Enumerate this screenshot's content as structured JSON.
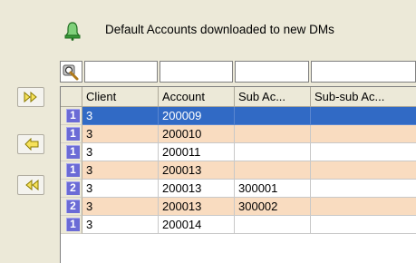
{
  "header": {
    "title": "Default Accounts downloaded to new DMs",
    "icon": "bell-icon"
  },
  "filters": {
    "icon": "search-filter-icon",
    "values": [
      "",
      "",
      "",
      ""
    ]
  },
  "side_buttons": [
    {
      "name": "add-all-button",
      "icon": "double-right-arrow-icon"
    },
    {
      "name": "remove-button",
      "icon": "left-arrow-icon"
    },
    {
      "name": "remove-all-button",
      "icon": "double-left-arrow-icon"
    }
  ],
  "table": {
    "columns": [
      "Client",
      "Account",
      "Sub Ac...",
      "Sub-sub Ac..."
    ],
    "rows": [
      {
        "level": "1",
        "client": "3",
        "account": "200009",
        "sub": "",
        "subsub": "",
        "selected": true
      },
      {
        "level": "1",
        "client": "3",
        "account": "200010",
        "sub": "",
        "subsub": ""
      },
      {
        "level": "1",
        "client": "3",
        "account": "200011",
        "sub": "",
        "subsub": ""
      },
      {
        "level": "1",
        "client": "3",
        "account": "200013",
        "sub": "",
        "subsub": ""
      },
      {
        "level": "2",
        "client": "3",
        "account": "200013",
        "sub": "300001",
        "subsub": ""
      },
      {
        "level": "2",
        "client": "3",
        "account": "200013",
        "sub": "300002",
        "subsub": ""
      },
      {
        "level": "1",
        "client": "3",
        "account": "200014",
        "sub": "",
        "subsub": ""
      }
    ]
  },
  "colors": {
    "selected": "#316ac5",
    "alt_row": "#f9dcc0",
    "badge": "#6b6bd6"
  }
}
